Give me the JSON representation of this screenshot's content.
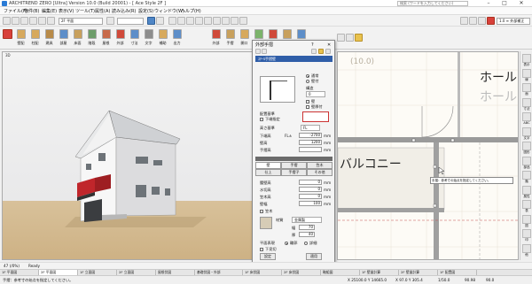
{
  "titlebar": {
    "title": "ARCHITREND ZERO [Ultra] Version 10.0 (Build 20001) - [ Ace Style 2F ]",
    "search_placeholder": "検索 (ワードを入力してください)",
    "minimize": "–",
    "maximize": "□",
    "close": "✕"
  },
  "menu": [
    "ファイル(F)",
    "物件(B)",
    "編集(E)",
    "表示(V)",
    "ツール(T)",
    "属性(A)",
    "読み込み(R)",
    "設定(S)",
    "ウィンドウ(W)",
    "ヘルプ(H)"
  ],
  "toolbar": {
    "floor_combo": "2F 平面",
    "layer_combo": "",
    "right_combo": "1.0 ≡ 外部補正"
  },
  "ribbon": [
    {
      "label": "壁配",
      "color": "#d7a95c"
    },
    {
      "label": "柱配",
      "color": "#d7a95c"
    },
    {
      "label": "建具",
      "color": "#b88a48"
    },
    {
      "label": "部屋",
      "color": "#5d8ec9"
    },
    {
      "label": "床面",
      "color": "#c8a05c"
    },
    {
      "label": "階段",
      "color": "#6d9d6a"
    },
    {
      "label": "屋根",
      "color": "#c86a4a"
    },
    {
      "label": "外部",
      "color": "#d04a3a"
    },
    {
      "label": "寸法",
      "color": "#5d8ec9"
    },
    {
      "label": "文字",
      "color": "#8d8d8d"
    },
    {
      "label": "補助",
      "color": "#d7a95c"
    },
    {
      "label": "出力",
      "color": "#5d8ec9"
    }
  ],
  "ribbon2": [
    {
      "label": "外部",
      "color": "#d04a3a"
    },
    {
      "label": "手摺",
      "color": "#c8a05c"
    },
    {
      "label": "開口",
      "color": "#d7a95c"
    },
    {
      "label": "付属",
      "color": "#7bb36a"
    },
    {
      "label": "外部",
      "color": "#d04a3a"
    },
    {
      "label": "屋外",
      "color": "#c8a05c"
    },
    {
      "label": "設備",
      "color": "#5d8ec9"
    }
  ],
  "view3d": {
    "label": "3D"
  },
  "dialog": {
    "title": "外部手摺",
    "help": "?",
    "close": "✕",
    "type_combo": "ｽﾁｰﾙ手摺壁",
    "radio_tsujo": "通常",
    "radio_tokui": "壁付",
    "kozo_label": "構造",
    "kozo_combo": "0",
    "chk_kabe": "壁",
    "chk_kabezuke": "壁厚付",
    "haichi_label": "配置基準",
    "chk_shitate": "下端指定",
    "kou_label": "高さ基準",
    "kou_combo": "FL",
    "shitahan_label": "下端高",
    "shitahan_prefix": "FL±",
    "shitahan_value": "-2700",
    "takasa_label": "壁高",
    "takasa_value": "1200",
    "tesuri_label": "手摺高",
    "tesuri_value": "",
    "unit": "mm",
    "tabs1": [
      "壁",
      "手摺",
      "笠木"
    ],
    "tabs2": [
      "仕上",
      "手摺子",
      "その他"
    ],
    "fields": [
      {
        "label": "腰壁高",
        "value": "0"
      },
      {
        "label": "水切高",
        "value": "0"
      },
      {
        "label": "笠木高",
        "value": "0"
      },
      {
        "label": "壁幅",
        "value": "100"
      }
    ],
    "chk_kasagi": "笠木",
    "zaishitsu_label": "材質",
    "zaishitsu_combo": "金属製",
    "haba_label": "幅",
    "haba_value": "70",
    "atsu_label": "厚",
    "atsu_value": "40",
    "hyomen_label": "平面表現",
    "hyomen_opt1": "輪郭",
    "hyomen_opt2": "詳細",
    "chk_shitamichi": "下見切",
    "bottom_btn1": "設定",
    "bottom_btn2": "適用",
    "bottom_tab1": "2D",
    "bottom_tab2": "手摺配置"
  },
  "plan": {
    "room1": "ホール",
    "room1b": "ホール",
    "balcony": "バルコニー",
    "tip": "手摺：参考寸の始点を指定してください。",
    "faded_dim": "(10.0)"
  },
  "rpanel": [
    {
      "label": "表示"
    },
    {
      "label": "線"
    },
    {
      "label": "面"
    },
    {
      "label": "寸法"
    },
    {
      "label": "ABC"
    },
    {
      "label": "文字"
    },
    {
      "label": "図形"
    },
    {
      "label": "部品"
    },
    {
      "label": "階"
    },
    {
      "label": "属性"
    },
    {
      "label": "表"
    },
    {
      "label": "図"
    },
    {
      "label": "印"
    },
    {
      "label": "他"
    }
  ],
  "pagebar": {
    "left": "47 (/0%)",
    "status": "Ready"
  },
  "tabs": [
    "1F 平面図",
    "2F 平面図",
    "1F 立面図",
    "2F 立面図",
    "屋根伏図",
    "基礎伏図・外部",
    "1F 床伏図",
    "2F 床伏図",
    "軸組図",
    "1F 壁量計算",
    "2F 壁量計算",
    "1F 配置図"
  ],
  "status": {
    "hint": "手摺：参考寸の始点を指定してください。",
    "coords": "X 25100.0  Y 14665.0",
    "zoom": "X 97.0  Y 305.4",
    "scale": "1/50.0",
    "num1": "90.98",
    "num2": "90.0"
  }
}
